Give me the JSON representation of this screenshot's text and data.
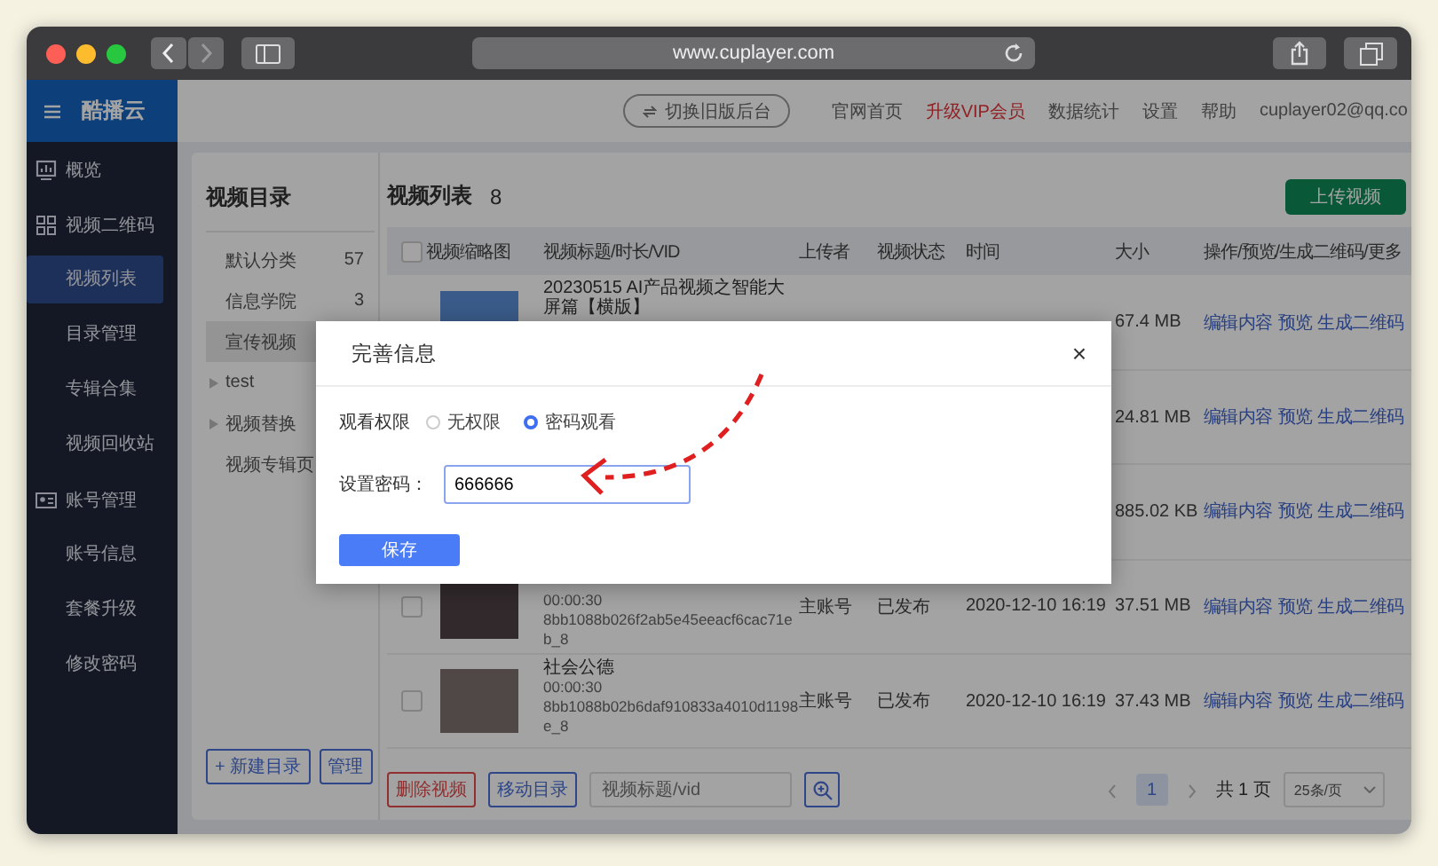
{
  "browser": {
    "url": "www.cuplayer.com"
  },
  "sidebar": {
    "logo": "酷播云",
    "items": [
      {
        "label": "概览",
        "selected": false
      },
      {
        "label": "视频二维码",
        "selected": false,
        "children": [
          {
            "label": "视频列表",
            "selected": true
          },
          {
            "label": "目录管理",
            "selected": false
          },
          {
            "label": "专辑合集",
            "selected": false
          },
          {
            "label": "视频回收站",
            "selected": false
          }
        ]
      },
      {
        "label": "账号管理",
        "selected": false,
        "children": [
          {
            "label": "账号信息",
            "selected": false
          },
          {
            "label": "套餐升级",
            "selected": false
          },
          {
            "label": "修改密码",
            "selected": false
          }
        ]
      }
    ]
  },
  "top_bar": {
    "switch_button": "切换旧版后台",
    "links": [
      {
        "label": "官网首页",
        "highlight": false
      },
      {
        "label": "升级VIP会员",
        "highlight": true
      },
      {
        "label": "数据统计",
        "highlight": false
      },
      {
        "label": "设置",
        "highlight": false
      },
      {
        "label": "帮助",
        "highlight": false
      }
    ],
    "user": "cuplayer02@qq.co"
  },
  "directory": {
    "title": "视频目录",
    "items": [
      {
        "label": "默认分类",
        "count": "57",
        "expandable": false,
        "selected": false
      },
      {
        "label": "信息学院",
        "count": "3",
        "expandable": false,
        "selected": false
      },
      {
        "label": "宣传视频",
        "expandable": false,
        "selected": true
      },
      {
        "label": "test",
        "expandable": true,
        "selected": false
      },
      {
        "label": "视频替换",
        "expandable": true,
        "selected": false
      },
      {
        "label": "视频专辑页",
        "expandable": false,
        "selected": false
      }
    ],
    "buttons": [
      "+ 新建目录",
      "管理"
    ]
  },
  "video_list": {
    "title": "视频列表",
    "count": "8",
    "upload_button": "上传视频",
    "columns": [
      "视频缩略图",
      "视频标题/时长/VID",
      "上传者",
      "视频状态",
      "时间",
      "大小",
      "操作/预览/生成二维码/更多"
    ],
    "header_checked": false,
    "rows": [
      {
        "title": "20230515 AI产品视频之智能大屏篇【横版】",
        "size": "67.4 MB",
        "actions": [
          "编辑内容",
          "预览",
          "生成二维码"
        ]
      },
      {
        "size": "24.81 MB",
        "actions": [
          "编辑内容",
          "预览",
          "生成二维码"
        ]
      },
      {
        "size": "885.02 KB",
        "actions": [
          "编辑内容",
          "预览",
          "生成二维码"
        ]
      },
      {
        "checked": false,
        "duration": "00:00:30",
        "vid": "8bb1088b026f2ab5e45eeacf6cac71eb_8",
        "uploader": "主账号",
        "status": "已发布",
        "time": "2020-12-10 16:19",
        "size": "37.51 MB",
        "actions": [
          "编辑内容",
          "预览",
          "生成二维码"
        ]
      },
      {
        "checked": false,
        "title": "社会公德",
        "duration": "00:00:30",
        "vid": "8bb1088b02b6daf910833a4010d1198e_8",
        "uploader": "主账号",
        "status": "已发布",
        "time": "2020-12-10 16:19",
        "size": "37.43 MB",
        "actions": [
          "编辑内容",
          "预览",
          "生成二维码"
        ]
      }
    ],
    "footer": {
      "delete_button": "删除视频",
      "move_button": "移动目录",
      "search_placeholder": "视频标题/vid",
      "pages": [
        {
          "label": "1",
          "selected": true
        }
      ],
      "total": "共 1 页",
      "page_size": "25条/页"
    }
  },
  "dialog": {
    "title": "完善信息",
    "close": "×",
    "permission_label": "观看权限",
    "options": [
      {
        "label": "无权限",
        "selected": false
      },
      {
        "label": "密码观看",
        "selected": true
      }
    ],
    "password_label": "设置密码：",
    "password_value": "666666",
    "save_button": "保存"
  },
  "annotations": [
    {
      "kind": "curved-arrow"
    }
  ]
}
